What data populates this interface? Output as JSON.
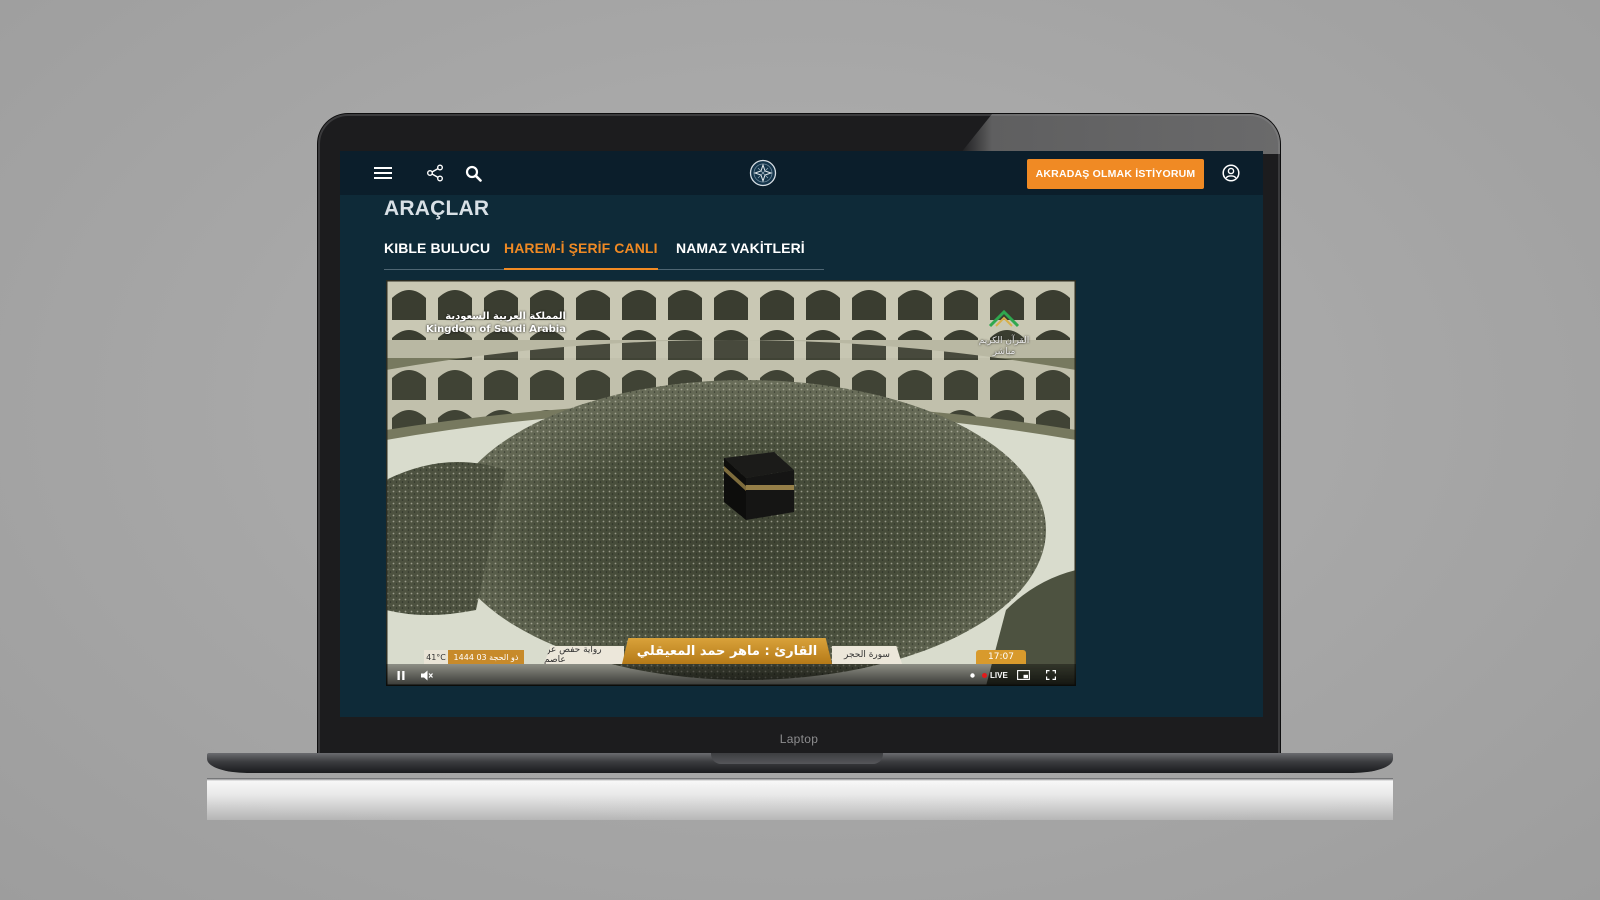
{
  "device": {
    "label": "Laptop"
  },
  "topbar": {
    "menu_icon": "hamburger-menu-icon",
    "share_icon": "share-icon",
    "search_icon": "search-icon",
    "logo_icon": "site-logo-icon",
    "cta_label": "AKRADAŞ OLMAK İSTİYORUM",
    "account_icon": "user-account-icon",
    "colors": {
      "bar": "#0b1e2b",
      "cta": "#f08a24"
    }
  },
  "page": {
    "title": "ARAÇLAR",
    "background": "#0e2a38"
  },
  "tabs": [
    {
      "label": "KIBLE BULUCU",
      "active": false
    },
    {
      "label": "HAREM-İ ŞERİF CANLI",
      "active": true
    },
    {
      "label": "NAMAZ VAKİTLERİ",
      "active": false
    }
  ],
  "video": {
    "broadcaster_logo_ar": "المملكة العربية السعودية",
    "broadcaster_logo_en": "Kingdom of Saudi Arabia",
    "channel_logo_line1": "القرآن الكريم",
    "channel_logo_line2": "مباشر",
    "overlay": {
      "temperature": "41°C",
      "hijri_date": "1444 ذو الحجة 03",
      "riwaya": "رواية حفص عن عاصم",
      "reciter": "القارئ : ماهر حمد المعيقلي",
      "surah": "سورة الحجر",
      "clock": "17:07"
    },
    "controls": {
      "pause_icon": "pause-icon",
      "mute_icon": "mute-icon",
      "live_label": "LIVE",
      "pip_icon": "picture-in-picture-icon",
      "fullscreen_icon": "fullscreen-icon"
    }
  }
}
